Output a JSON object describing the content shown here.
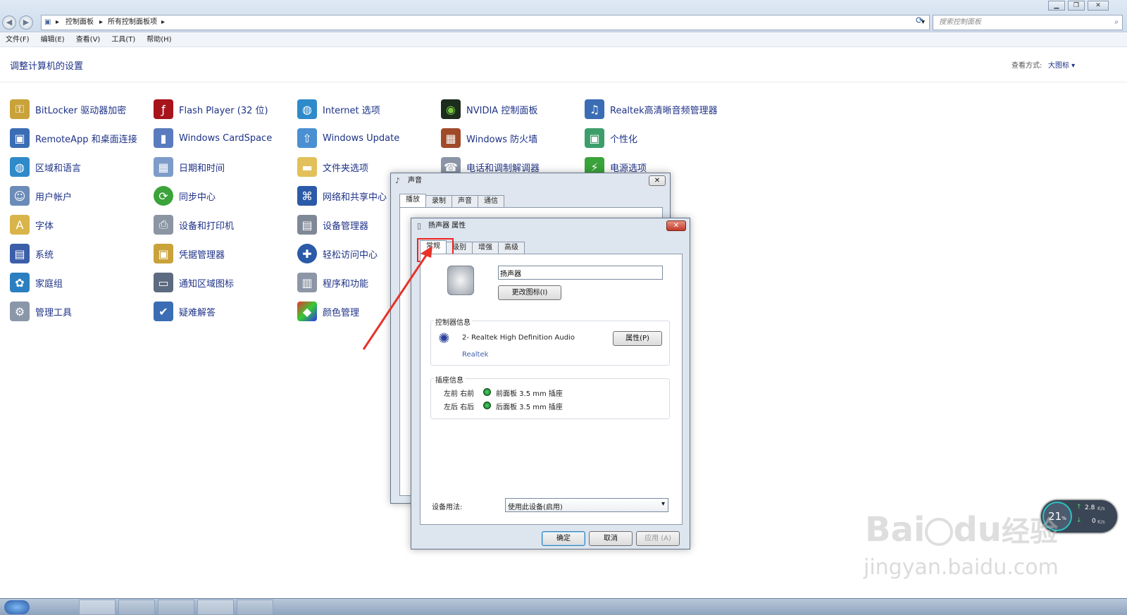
{
  "address": {
    "crumbs": [
      "控制面板",
      "所有控制面板项"
    ],
    "search_placeholder": "搜索控制面板"
  },
  "menu": [
    "文件(F)",
    "编辑(E)",
    "查看(V)",
    "工具(T)",
    "帮助(H)"
  ],
  "page": {
    "heading": "调整计算机的设置",
    "view_label": "查看方式:",
    "view_value": "大图标 ▾"
  },
  "items": [
    [
      "BitLocker 驱动器加密",
      "RemoteApp 和桌面连接",
      "区域和语言",
      "用户帐户",
      "字体",
      "系统",
      "家庭组",
      "管理工具"
    ],
    [
      "Flash Player (32 位)",
      "Windows CardSpace",
      "日期和时间",
      "同步中心",
      "设备和打印机",
      "凭据管理器",
      "通知区域图标",
      "疑难解答"
    ],
    [
      "Internet 选项",
      "Windows Update",
      "文件夹选项",
      "网络和共享中心",
      "设备管理器",
      "轻松访问中心",
      "程序和功能",
      "颜色管理"
    ],
    [
      "NVIDIA 控制面板",
      "Windows 防火墙",
      "电话和调制解调器"
    ],
    [
      "Realtek高清晰音频管理器",
      "个性化",
      "电源选项"
    ]
  ],
  "sound_dialog": {
    "title": "声音",
    "tabs": [
      "播放",
      "录制",
      "声音",
      "通信"
    ]
  },
  "speaker_dialog": {
    "title": "扬声器 属性",
    "tabs": [
      "常规",
      "级别",
      "增强",
      "高级"
    ],
    "name_value": "扬声器",
    "change_icon": "更改图标(I)",
    "controller_title": "控制器信息",
    "controller_name": "2- Realtek High Definition Audio",
    "controller_vendor": "Realtek",
    "properties_btn": "属性(P)",
    "jack_title": "插座信息",
    "jacks": [
      {
        "pos": "左前 右前",
        "desc": "前面板 3.5 mm 插座"
      },
      {
        "pos": "左后 右后",
        "desc": "后面板 3.5 mm 插座"
      }
    ],
    "usage_label": "设备用法:",
    "usage_value": "使用此设备(启用)",
    "ok": "确定",
    "cancel": "取消",
    "apply": "应用 (A)"
  },
  "widget": {
    "percent": "21",
    "percent_unit": "%",
    "up": "2.8",
    "up_unit": "K/s",
    "down": "0",
    "down_unit": "K/s"
  },
  "watermark": {
    "brand": "Bai",
    "brand2": "du",
    "brand3": "经验",
    "url": "jingyan.baidu.com"
  }
}
